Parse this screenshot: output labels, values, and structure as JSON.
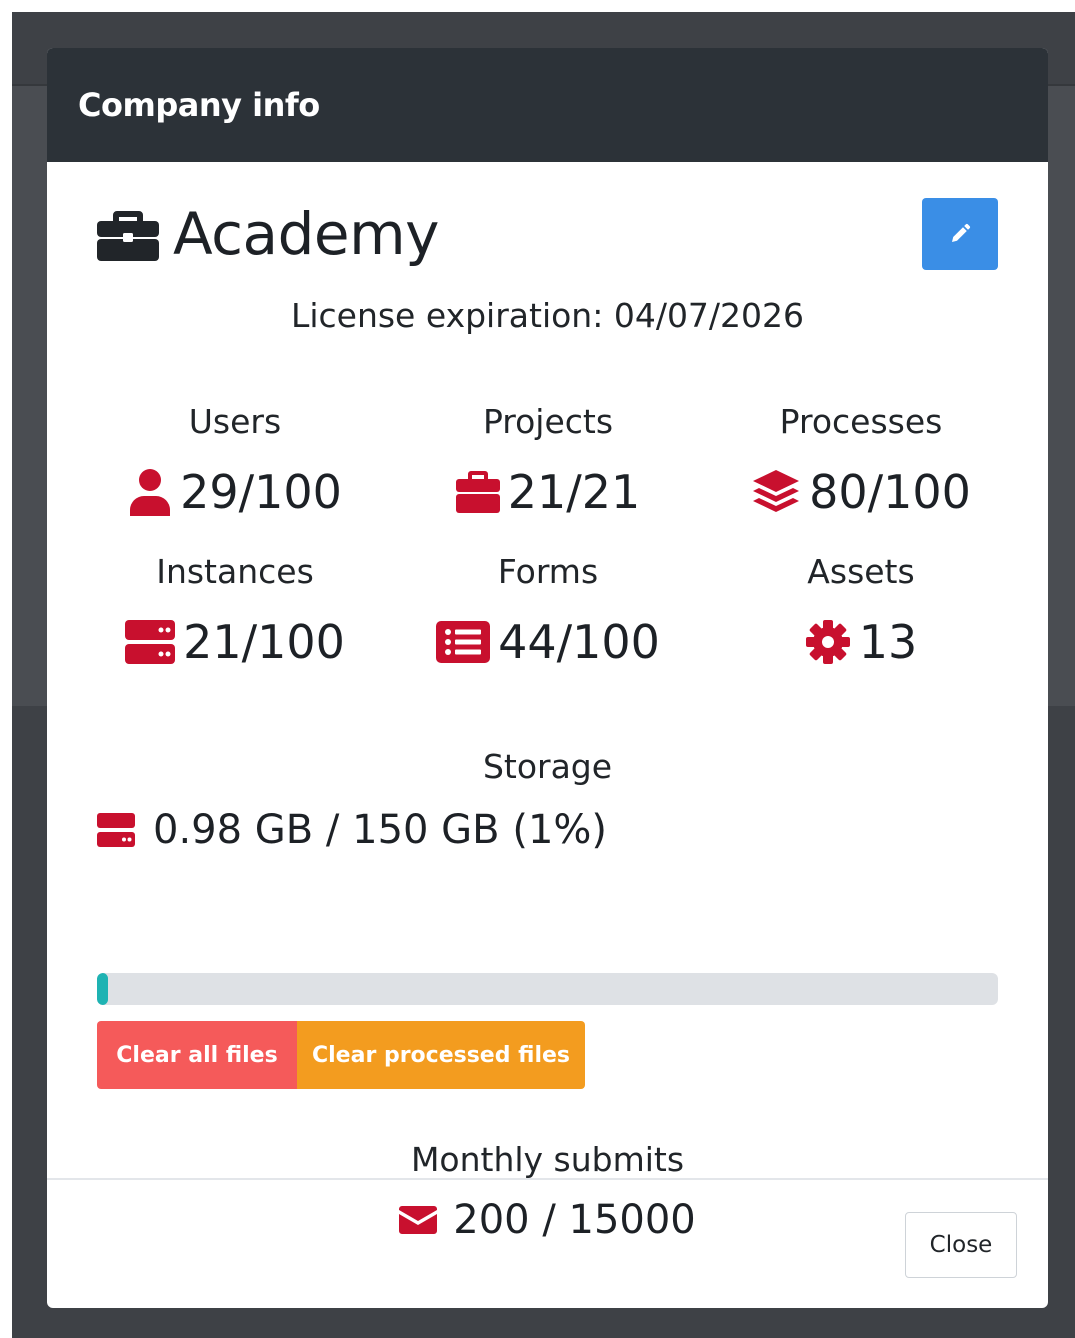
{
  "modal": {
    "title": "Company info",
    "company_name": "Academy",
    "license_text": "License expiration: 04/07/2026"
  },
  "stats": [
    {
      "label": "Users",
      "value": "29/100",
      "icon": "user-icon"
    },
    {
      "label": "Projects",
      "value": "21/21",
      "icon": "briefcase-icon"
    },
    {
      "label": "Processes",
      "value": "80/100",
      "icon": "layers-icon"
    },
    {
      "label": "Instances",
      "value": "21/100",
      "icon": "server-icon"
    },
    {
      "label": "Forms",
      "value": "44/100",
      "icon": "list-icon"
    },
    {
      "label": "Assets",
      "value": "13",
      "icon": "gear-icon"
    }
  ],
  "storage": {
    "label": "Storage",
    "value": "0.98 GB / 150 GB (1%)",
    "percent": 1,
    "clear_all_label": "Clear all files",
    "clear_processed_label": "Clear processed files"
  },
  "submits": {
    "label": "Monthly submits",
    "value": "200 / 15000"
  },
  "footer": {
    "close_label": "Close"
  },
  "colors": {
    "header_bg": "#2c3238",
    "accent_red": "#c8102e",
    "edit_blue": "#3a8ee6",
    "danger": "#f55a5a",
    "warning": "#f39c1f",
    "progress": "#1eb3b3"
  }
}
